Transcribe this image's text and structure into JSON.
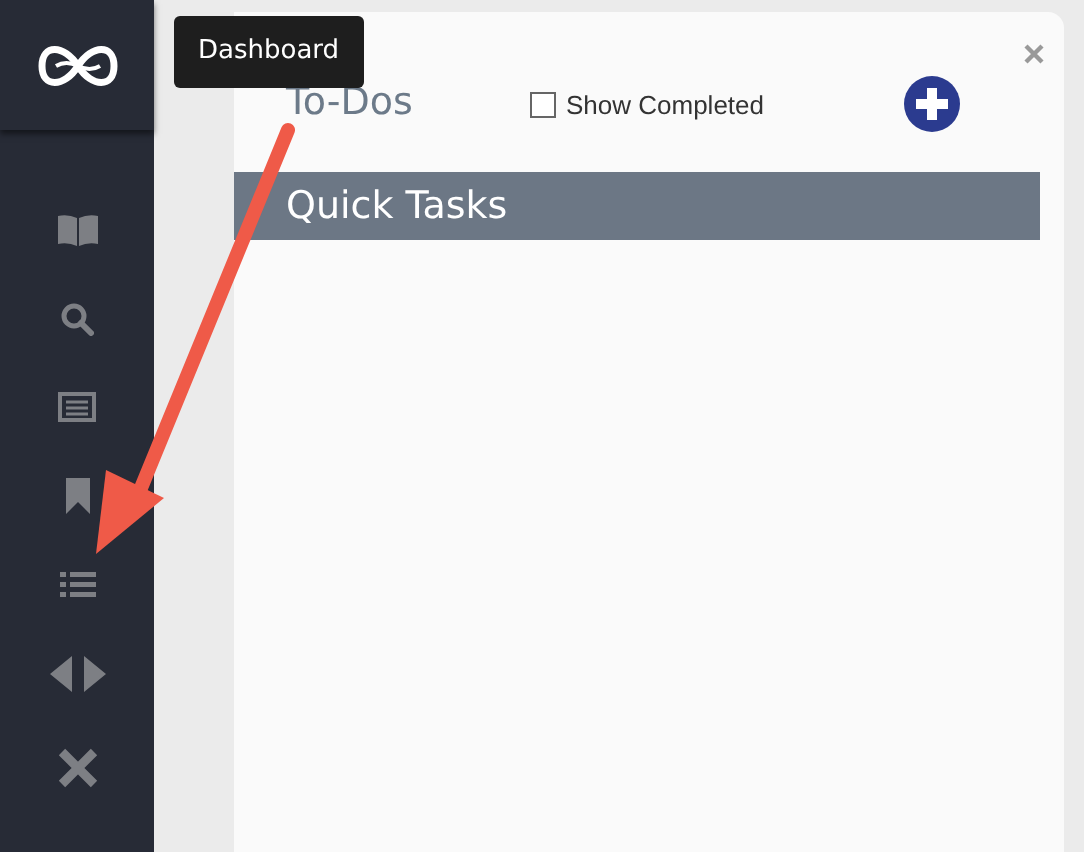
{
  "sidebar": {
    "items": [
      {
        "kind": "book"
      },
      {
        "kind": "search"
      },
      {
        "kind": "list-alt"
      },
      {
        "kind": "bookmark"
      },
      {
        "kind": "list"
      },
      {
        "kind": "arrows"
      },
      {
        "kind": "close"
      }
    ]
  },
  "tooltip": {
    "text": "Dashboard"
  },
  "panel": {
    "title": "To-Dos",
    "show_completed": {
      "label": "Show Completed",
      "checked": false
    },
    "section": {
      "title": "Quick Tasks"
    }
  }
}
